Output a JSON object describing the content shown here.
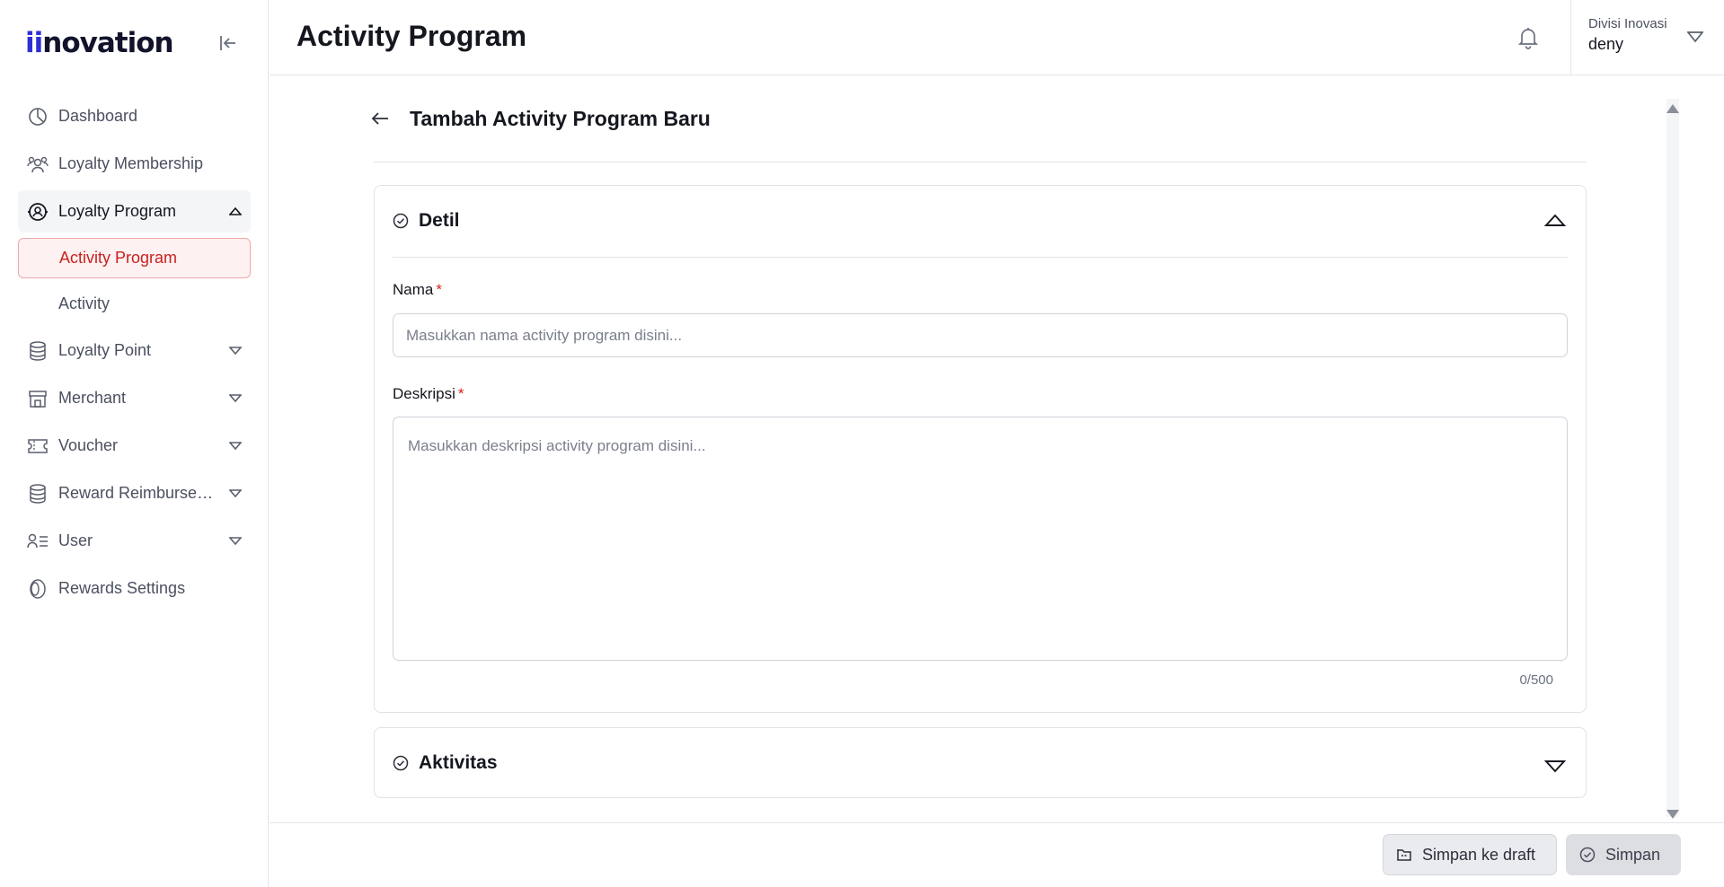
{
  "app": {
    "logo_text": "innovation"
  },
  "header": {
    "title": "Activity Program",
    "user_division": "Divisi Inovasi",
    "user_name": "deny"
  },
  "sidebar": {
    "items": [
      {
        "label": "Dashboard",
        "icon": "dashboard-icon"
      },
      {
        "label": "Loyalty Membership",
        "icon": "members-icon"
      },
      {
        "label": "Loyalty Program",
        "icon": "loyalty-program-icon",
        "expanded": true,
        "children": [
          {
            "label": "Activity Program",
            "active": true
          },
          {
            "label": "Activity"
          }
        ]
      },
      {
        "label": "Loyalty Point",
        "icon": "coins-icon"
      },
      {
        "label": "Merchant",
        "icon": "store-icon"
      },
      {
        "label": "Voucher",
        "icon": "ticket-icon"
      },
      {
        "label": "Reward Reimbursem...",
        "icon": "coins-icon"
      },
      {
        "label": "User",
        "icon": "user-list-icon"
      },
      {
        "label": "Rewards Settings",
        "icon": "gear-coin-icon"
      }
    ]
  },
  "form": {
    "title": "Tambah Activity Program Baru",
    "section_detil": "Detil",
    "nama_label": "Nama",
    "nama_placeholder": "Masukkan nama activity program disini...",
    "deskripsi_label": "Deskripsi",
    "deskripsi_placeholder": "Masukkan deskripsi activity program disini...",
    "counter": "0/500",
    "required_mark": "*",
    "section_aktivitas": "Aktivitas"
  },
  "footer": {
    "draft_label": "Simpan ke draft",
    "save_label": "Simpan"
  },
  "colors": {
    "accent": "#c8221f",
    "active_bg": "#fdf1f1",
    "brand": "#2f2fd6"
  }
}
